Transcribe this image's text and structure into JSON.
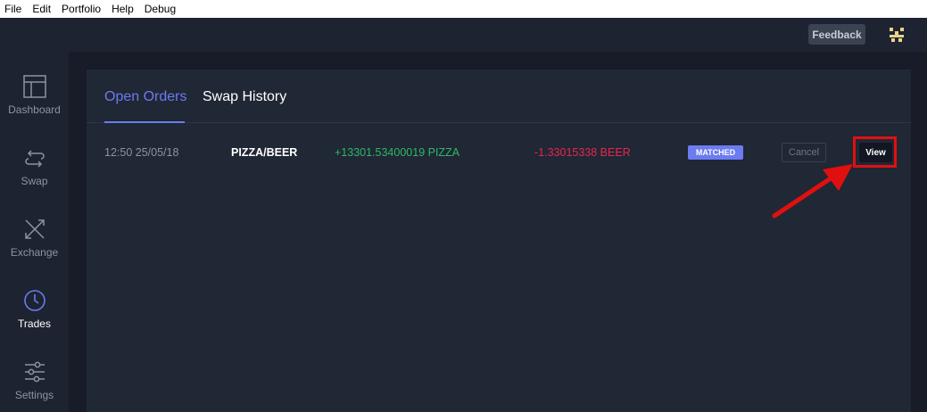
{
  "menu": [
    "File",
    "Edit",
    "Portfolio",
    "Help",
    "Debug"
  ],
  "header": {
    "feedback_label": "Feedback",
    "avatar_icon": "avatar-identicon"
  },
  "sidebar": {
    "items": [
      {
        "label": "Dashboard",
        "icon": "dashboard-icon"
      },
      {
        "label": "Swap",
        "icon": "swap-icon"
      },
      {
        "label": "Exchange",
        "icon": "exchange-icon"
      },
      {
        "label": "Trades",
        "icon": "trades-clock-icon",
        "active": true
      },
      {
        "label": "Settings",
        "icon": "settings-sliders-icon"
      }
    ]
  },
  "tabs": {
    "open_orders": "Open Orders",
    "swap_history": "Swap History",
    "active": "Open Orders"
  },
  "orders": [
    {
      "time": "12:50 25/05/18",
      "pair": "PIZZA/BEER",
      "receive": "+13301.53400019 PIZZA",
      "send": "-1.33015338 BEER",
      "status": "MATCHED",
      "cancel_label": "Cancel",
      "view_label": "View"
    }
  ],
  "colors": {
    "accent": "#6b7bf0",
    "positive": "#2fb866",
    "negative": "#e8264d",
    "annotation": "#e01010"
  }
}
